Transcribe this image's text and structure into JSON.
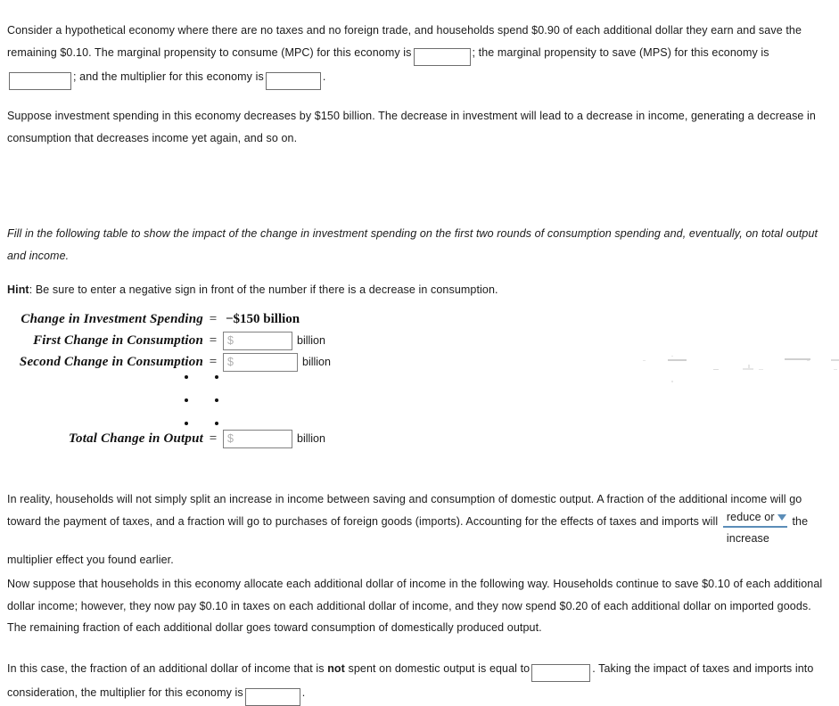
{
  "intro": {
    "p1_part1": "Consider a hypothetical economy where there are no taxes and no foreign trade, and households spend $0.90 of each additional dollar they earn and save the remaining $0.10. The marginal propensity to consume (MPC) for this economy is",
    "p1_part2": "; the marginal propensity to save (MPS) for this economy is",
    "p1_part3": "; and the multiplier for this economy is",
    "p1_part4": ".",
    "mpc_value": "",
    "mpc_placeholder": "",
    "mps_value": "",
    "mps_placeholder": "",
    "multiplier_value": "",
    "multiplier_placeholder": ""
  },
  "investment": {
    "p2": "Suppose investment spending in this economy decreases by $150 billion. The decrease in investment will lead to a decrease in income, generating a decrease in consumption that decreases income yet again, and so on."
  },
  "instructions": {
    "fill_in": "Fill in the following table to show the impact of the change in investment spending on the first two rounds of consumption spending and, eventually, on total output and income.",
    "hint_label": "Hint",
    "hint_text": ": Be sure to enter a negative sign in front of the number if there is a decrease in consumption."
  },
  "table": {
    "equals_sign": "=",
    "unit_label": "billion",
    "rows": [
      {
        "label": "Change in Investment Spending",
        "type": "static",
        "value": "−$150 billion"
      },
      {
        "label": "First Change in Consumption",
        "type": "input",
        "value": "",
        "placeholder": "$",
        "unit": "billion"
      },
      {
        "label": "Second Change in Consumption",
        "type": "input",
        "value": "",
        "placeholder": "$",
        "unit": "billion"
      },
      {
        "label": "Total Change in Output",
        "type": "input",
        "value": "",
        "placeholder": "$",
        "unit": "billion"
      }
    ]
  },
  "reality": {
    "p3_part1": "In reality, households will not simply split an increase in income between saving and consumption of domestic output. A fraction of the additional income will go toward the payment of taxes, and a fraction will go to purchases of foreign goods (imports). Accounting for the effects of taxes and imports will",
    "p3_part2": "the multiplier effect you found earlier.",
    "dropdown": {
      "line1": "reduce or",
      "line2": "increase",
      "selected": "reduce or increase",
      "options": [
        "reduce",
        "increase"
      ]
    }
  },
  "allocation": {
    "p4": "Now suppose that households in this economy allocate each additional dollar of income in the following way. Households continue to save $0.10 of each additional dollar income; however, they now pay $0.10 in taxes on each additional dollar of income, and they now spend $0.20 of each additional dollar on imported goods. The remaining fraction of each additional dollar goes toward consumption of domestically produced output."
  },
  "final": {
    "p5_part1": "In this case, the fraction of an additional dollar of income that is",
    "p5_bold": "not",
    "p5_part2": "spent on domestic output is equal to",
    "p5_part3": ". Taking the impact of taxes and imports into consideration, the multiplier for this economy is",
    "p5_part4": ".",
    "fraction_value": "",
    "fraction_placeholder": "",
    "multiplier_value": "",
    "multiplier_placeholder": ""
  }
}
